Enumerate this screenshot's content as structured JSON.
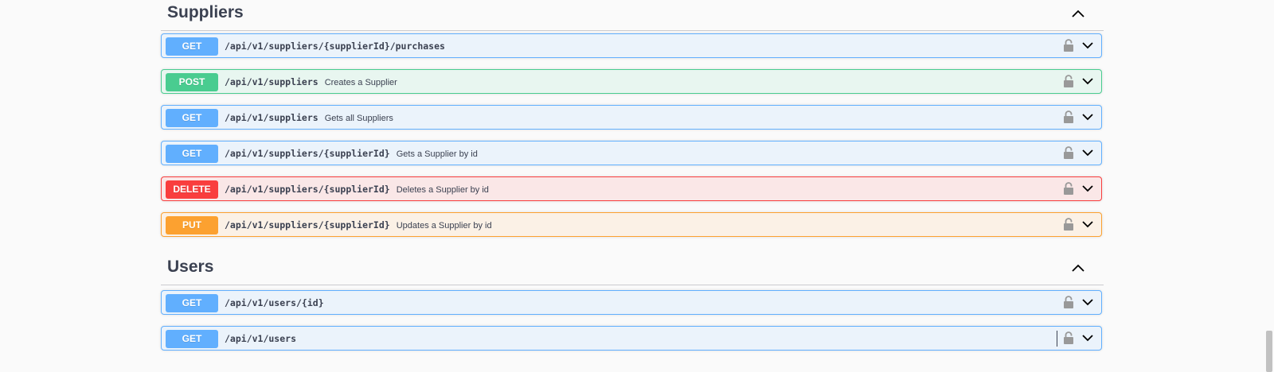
{
  "colors": {
    "get": "#61affe",
    "post": "#49cc90",
    "delete": "#f93e3e",
    "put": "#fca130",
    "text": "#3b4151"
  },
  "icons": {
    "section_toggle": "chevron-up-icon",
    "lock": "lock-icon",
    "expand": "chevron-down-icon"
  },
  "sections": [
    {
      "title": "Suppliers",
      "operations": [
        {
          "method": "GET",
          "path": "/api/v1/suppliers/{supplierId}/purchases",
          "summary": ""
        },
        {
          "method": "POST",
          "path": "/api/v1/suppliers",
          "summary": "Creates a Supplier"
        },
        {
          "method": "GET",
          "path": "/api/v1/suppliers",
          "summary": "Gets all Suppliers"
        },
        {
          "method": "GET",
          "path": "/api/v1/suppliers/{supplierId}",
          "summary": "Gets a Supplier by id"
        },
        {
          "method": "DELETE",
          "path": "/api/v1/suppliers/{supplierId}",
          "summary": "Deletes a Supplier by id"
        },
        {
          "method": "PUT",
          "path": "/api/v1/suppliers/{supplierId}",
          "summary": "Updates a Supplier by id"
        }
      ]
    },
    {
      "title": "Users",
      "operations": [
        {
          "method": "GET",
          "path": "/api/v1/users/{id}",
          "summary": ""
        },
        {
          "method": "GET",
          "path": "/api/v1/users",
          "summary": ""
        }
      ]
    }
  ]
}
